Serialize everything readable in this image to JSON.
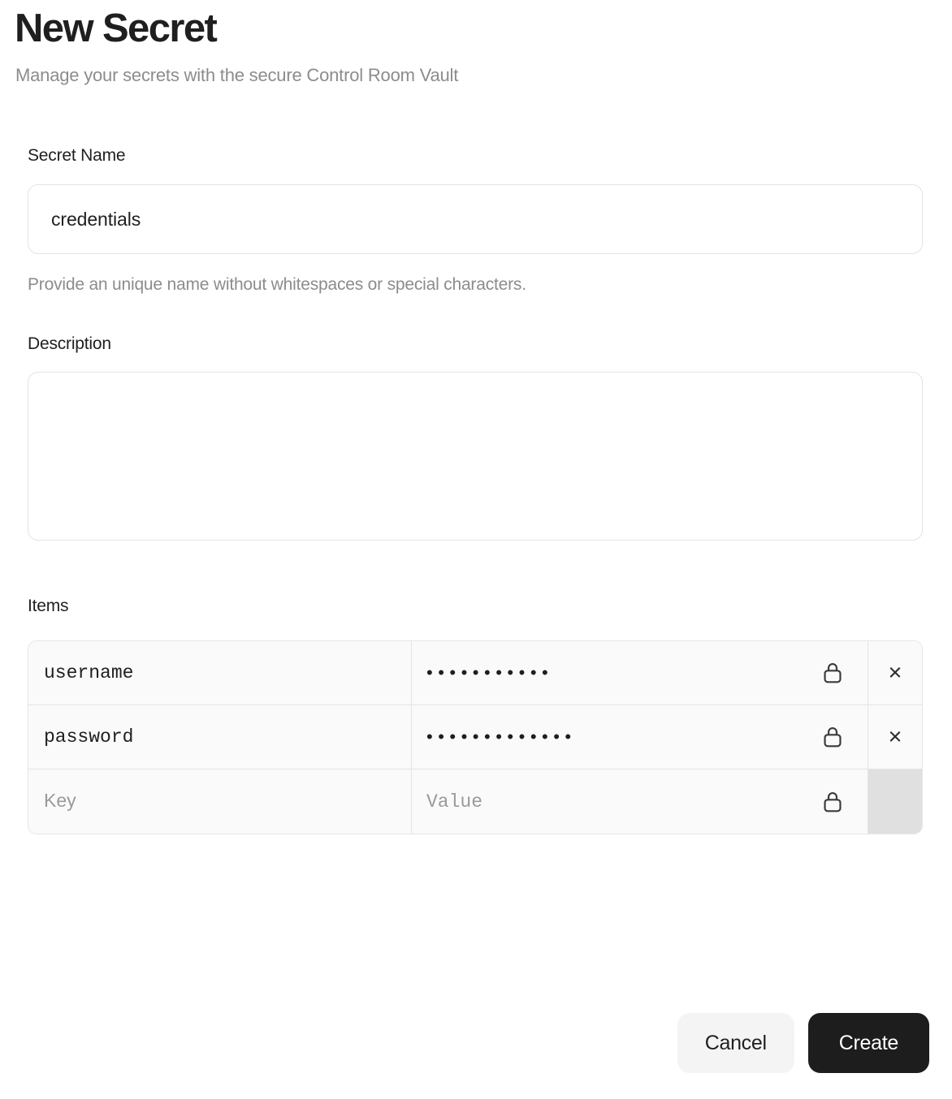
{
  "header": {
    "title": "New Secret",
    "subtitle": "Manage your secrets with the secure Control Room Vault"
  },
  "form": {
    "secret_name": {
      "label": "Secret Name",
      "value": "credentials",
      "placeholder": "",
      "helper": "Provide an unique name without whitespaces or special characters."
    },
    "description": {
      "label": "Description",
      "value": "",
      "placeholder": ""
    },
    "items": {
      "label": "Items",
      "key_placeholder": "Key",
      "value_placeholder": "Value",
      "lock_icon": "lock-icon",
      "remove_icon": "close-icon",
      "remove_label": "×",
      "rows": [
        {
          "key": "username",
          "value_masked": "•••••••••••",
          "locked": true,
          "removable": true
        },
        {
          "key": "password",
          "value_masked": "•••••••••••••",
          "locked": true,
          "removable": true
        },
        {
          "key": "",
          "value_masked": "",
          "locked": true,
          "removable": false
        }
      ]
    }
  },
  "footer": {
    "cancel_label": "Cancel",
    "create_label": "Create"
  },
  "colors": {
    "text_primary": "#1f1f1f",
    "text_muted": "#8c8c8c",
    "border": "#e3e3e3",
    "row_bg": "#fafafa",
    "disabled_bg": "#e0e0e0",
    "primary_button_bg": "#1d1d1d",
    "secondary_button_bg": "#f4f4f4"
  }
}
